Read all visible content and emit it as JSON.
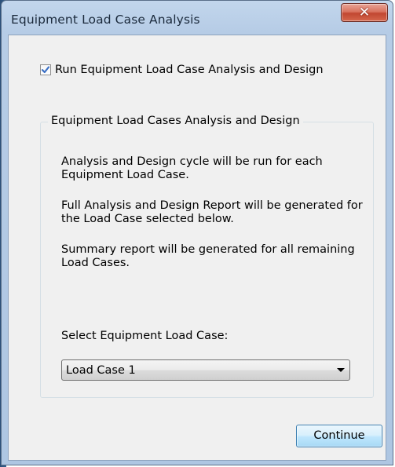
{
  "window": {
    "title": "Equipment Load Case Analysis",
    "close_icon": "close-icon",
    "close_glyph": "✕"
  },
  "run_checkbox": {
    "label": "Run Equipment Load Case Analysis and Design",
    "checked": true
  },
  "group": {
    "title": "Equipment Load Cases Analysis and Design",
    "paragraphs": [
      "Analysis and Design cycle will be run for each Equipment Load Case.",
      "Full Analysis and Design Report will be generated for the Load Case selected below.",
      "Summary report will be generated for all remaining Load Cases."
    ],
    "select_label": "Select Equipment Load Case:",
    "select_value": "Load Case 1"
  },
  "buttons": {
    "continue_label": "Continue"
  },
  "colors": {
    "client_bg": "#f0f0f0",
    "close_button": "#c14731",
    "default_button_border": "#3c7fb1"
  }
}
